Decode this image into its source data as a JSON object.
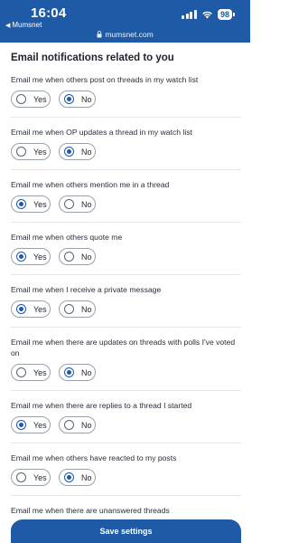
{
  "status_bar": {
    "time": "16:04",
    "back_app": "Mumsnet",
    "battery": "98",
    "url": "mumsnet.com"
  },
  "page": {
    "heading": "Email notifications related to you",
    "yes_label": "Yes",
    "no_label": "No",
    "questions": [
      {
        "text": "Email me when others post on threads in my watch list",
        "selected": "no"
      },
      {
        "text": "Email me when OP updates a thread in my watch list",
        "selected": "no"
      },
      {
        "text": "Email me when others mention me in a thread",
        "selected": "yes"
      },
      {
        "text": "Email me when others quote me",
        "selected": "yes"
      },
      {
        "text": "Email me when I receive a private message",
        "selected": "yes"
      },
      {
        "text": "Email me when there are updates on threads with polls I've voted on",
        "selected": "no"
      },
      {
        "text": "Email me when there are replies to a thread I started",
        "selected": "yes"
      },
      {
        "text": "Email me when others have reacted to my posts",
        "selected": "no"
      },
      {
        "text": "Email me when there are unanswered threads",
        "selected": "no"
      }
    ],
    "save_label": "Save settings"
  },
  "colors": {
    "brand_blue": "#1f5aa6"
  },
  "icons": {
    "back": "triangle-left-icon",
    "signal": "cellular-signal-icon",
    "wifi": "wifi-icon",
    "battery": "battery-icon",
    "lock": "lock-icon"
  }
}
